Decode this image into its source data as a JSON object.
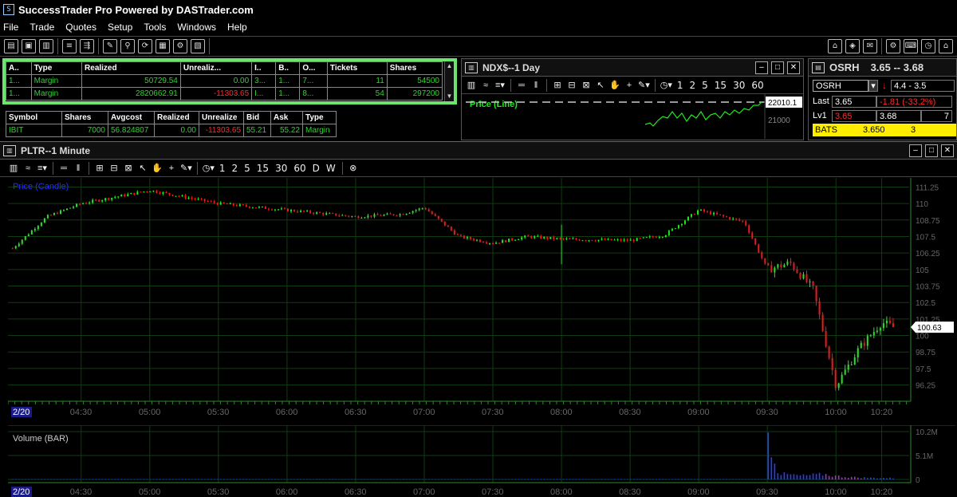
{
  "app": {
    "title": "SuccessTrader Pro Powered by DASTrader.com",
    "menu": [
      "File",
      "Trade",
      "Quotes",
      "Setup",
      "Tools",
      "Windows",
      "Help"
    ]
  },
  "colors": {
    "accent_green": "#6be56b",
    "up_candle": "#22e822",
    "down_candle": "#ee1a1a",
    "grid": "#0f3d0f",
    "volume_blue": "#2c3cff",
    "volume_purple": "#9a37c8"
  },
  "account_table": {
    "headers": [
      "A..",
      "Type",
      "Realized",
      "Unrealiz...",
      "I..",
      "B..",
      "O...",
      "Tickets",
      "Shares"
    ],
    "rows": [
      [
        "1...",
        "Margin",
        "50729.54",
        "0.00",
        "3...",
        "1...",
        "7...",
        "11",
        "54500"
      ],
      [
        "1...",
        "Margin",
        "2820662.91",
        "-11303.65",
        "I...",
        "1...",
        "8...",
        "54",
        "297200"
      ]
    ]
  },
  "position_table": {
    "headers": [
      "Symbol",
      "Shares",
      "Avgcost",
      "Realized",
      "Unrealize",
      "Bid",
      "Ask",
      "Type"
    ],
    "row": [
      "IBIT",
      "7000",
      "56.824807",
      "0.00",
      "-11303.65",
      "55.21",
      "55.22",
      "Margin"
    ]
  },
  "ndx_window": {
    "title": "NDX$--1 Day",
    "series_label": "Price (Line)",
    "last_price": "22010.1",
    "axis_label": "21000",
    "timeframes": [
      "1",
      "2",
      "5",
      "15",
      "30",
      "60"
    ]
  },
  "osrh_window": {
    "title": "OSRH",
    "bid_ask": "3.65 -- 3.68",
    "symbol_input": "OSRH",
    "range": "4.4 - 3.5",
    "last_label": "Last",
    "last_value": "3.65",
    "change": "-1.81  (-33.2%)",
    "lv1_label": "Lv1",
    "lv1_bid": "3.65",
    "lv1_ask": "3.68",
    "lv1_extra": "7",
    "exchange": "BATS",
    "exchange_price": "3.650",
    "exchange_size": "3"
  },
  "pltr_window": {
    "title": "PLTR--1 Minute",
    "price_label": "Price (Candle)",
    "volume_label": "Volume (BAR)",
    "last_price": "100.63",
    "timeframes": [
      "1",
      "2",
      "5",
      "15",
      "30",
      "60",
      "D",
      "W"
    ]
  },
  "chart_data": {
    "type": "candlestick",
    "title": "PLTR--1 Minute",
    "date_label": "2/20",
    "x_ticks": [
      "04:30",
      "05:00",
      "05:30",
      "06:00",
      "06:30",
      "07:00",
      "07:30",
      "08:00",
      "08:30",
      "09:00",
      "09:30",
      "10:00",
      "10:20"
    ],
    "y_ticks": [
      "111.25",
      "110",
      "108.75",
      "107.5",
      "106.25",
      "105",
      "103.75",
      "102.5",
      "101.25",
      "100",
      "98.75",
      "97.5",
      "96.25"
    ],
    "ylim": [
      95.5,
      111.7
    ],
    "volume_ticks": [
      "10.2M",
      "5.1M",
      "0"
    ],
    "volume_ylim": [
      0,
      10.2
    ],
    "grid": true,
    "last_value": 100.63,
    "price_path": [
      {
        "t": "04:00",
        "p": 106.6
      },
      {
        "t": "04:15",
        "p": 109.0
      },
      {
        "t": "04:30",
        "p": 110.0
      },
      {
        "t": "05:00",
        "p": 111.0
      },
      {
        "t": "05:30",
        "p": 110.0
      },
      {
        "t": "06:00",
        "p": 109.5
      },
      {
        "t": "06:30",
        "p": 109.0
      },
      {
        "t": "06:50",
        "p": 109.2
      },
      {
        "t": "07:00",
        "p": 109.7
      },
      {
        "t": "07:15",
        "p": 107.5
      },
      {
        "t": "07:30",
        "p": 107.0
      },
      {
        "t": "07:45",
        "p": 107.5
      },
      {
        "t": "08:00",
        "p": 107.3
      },
      {
        "t": "08:30",
        "p": 107.2
      },
      {
        "t": "08:45",
        "p": 107.6
      },
      {
        "t": "09:00",
        "p": 109.5
      },
      {
        "t": "09:20",
        "p": 108.6
      },
      {
        "t": "09:30",
        "p": 105.0
      },
      {
        "t": "09:40",
        "p": 105.5
      },
      {
        "t": "09:50",
        "p": 103.5
      },
      {
        "t": "10:00",
        "p": 96.2
      },
      {
        "t": "10:10",
        "p": 99.0
      },
      {
        "t": "10:20",
        "p": 101.0
      },
      {
        "t": "10:25",
        "p": 100.63
      }
    ],
    "volume_path": [
      {
        "t": "09:30",
        "v": 10.0
      },
      {
        "t": "09:35",
        "v": 1.2
      },
      {
        "t": "09:45",
        "v": 0.8
      },
      {
        "t": "09:55",
        "v": 1.1
      },
      {
        "t": "10:00",
        "v": 0.7
      },
      {
        "t": "10:10",
        "v": 0.4
      },
      {
        "t": "10:20",
        "v": 0.3
      }
    ]
  }
}
